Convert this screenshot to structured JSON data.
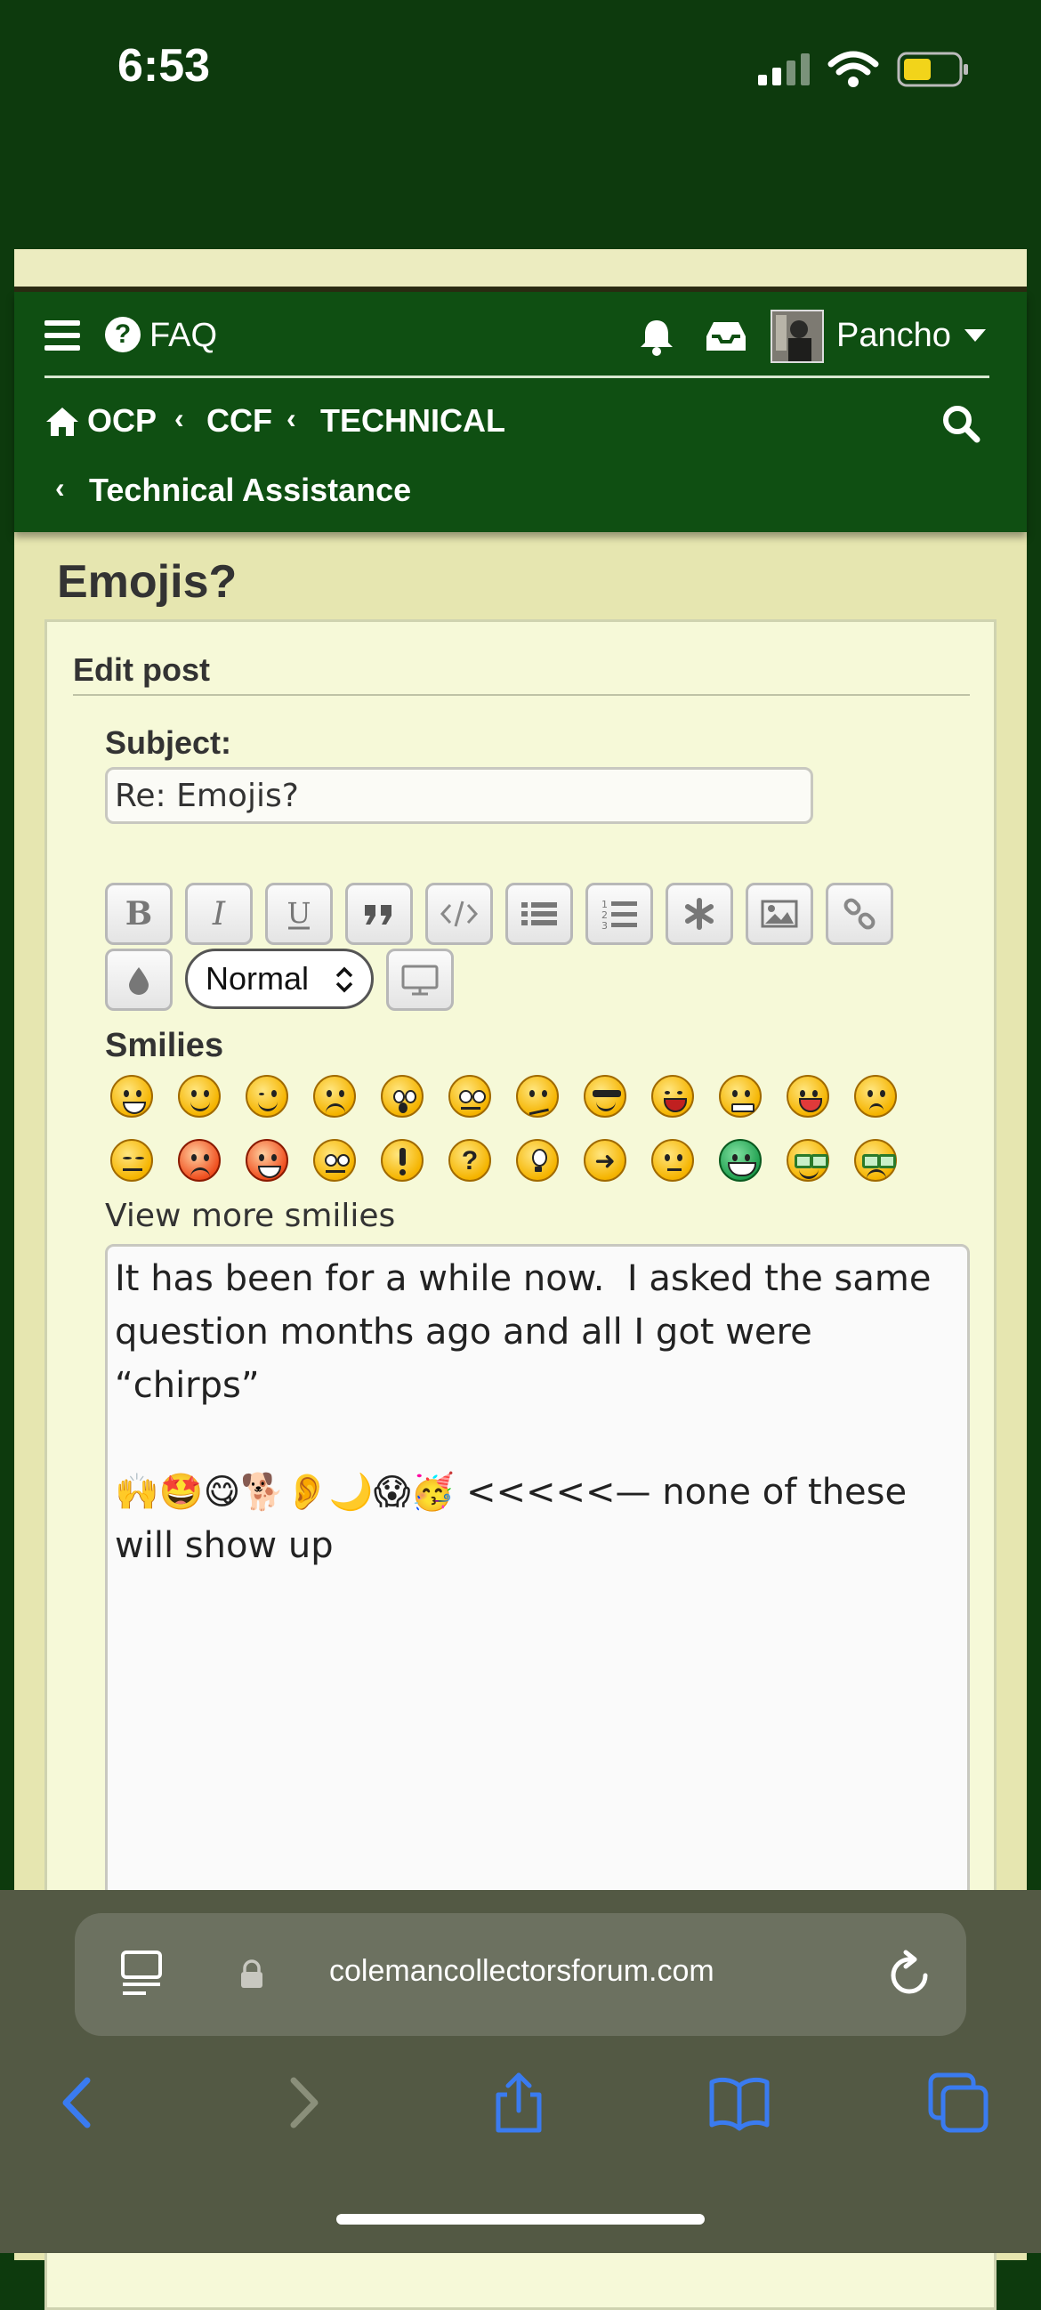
{
  "status_bar": {
    "time": "6:53"
  },
  "header": {
    "faq_label": "FAQ",
    "username": "Pancho",
    "breadcrumbs": [
      "OCP",
      "CCF",
      "TECHNICAL"
    ],
    "sub_breadcrumb": "Technical Assistance"
  },
  "page": {
    "title": "Emojis?",
    "panel_heading": "Edit post"
  },
  "form": {
    "subject_label": "Subject:",
    "subject_value": "Re: Emojis?",
    "toolbar": {
      "buttons": [
        "bold",
        "italic",
        "underline",
        "quote",
        "code",
        "list",
        "numbered-list",
        "list-item",
        "image",
        "link",
        "color"
      ],
      "size_select_value": "Normal"
    },
    "smilies_label": "Smilies",
    "view_more_label": "View more smilies",
    "message": "It has been for a while now.  I asked the same question months ago and all I got were “chirps”\n\n🙌🤩😋🐕👂🌙😱🥳 <<<<<— none of these will show up"
  },
  "browser": {
    "url": "colemancollectorsforum.com"
  },
  "colors": {
    "header_green": "#0f4f12",
    "panel_bg": "#f6f9d8",
    "page_bg": "#e6e6b0",
    "safari_blue": "#3a7bf0"
  }
}
